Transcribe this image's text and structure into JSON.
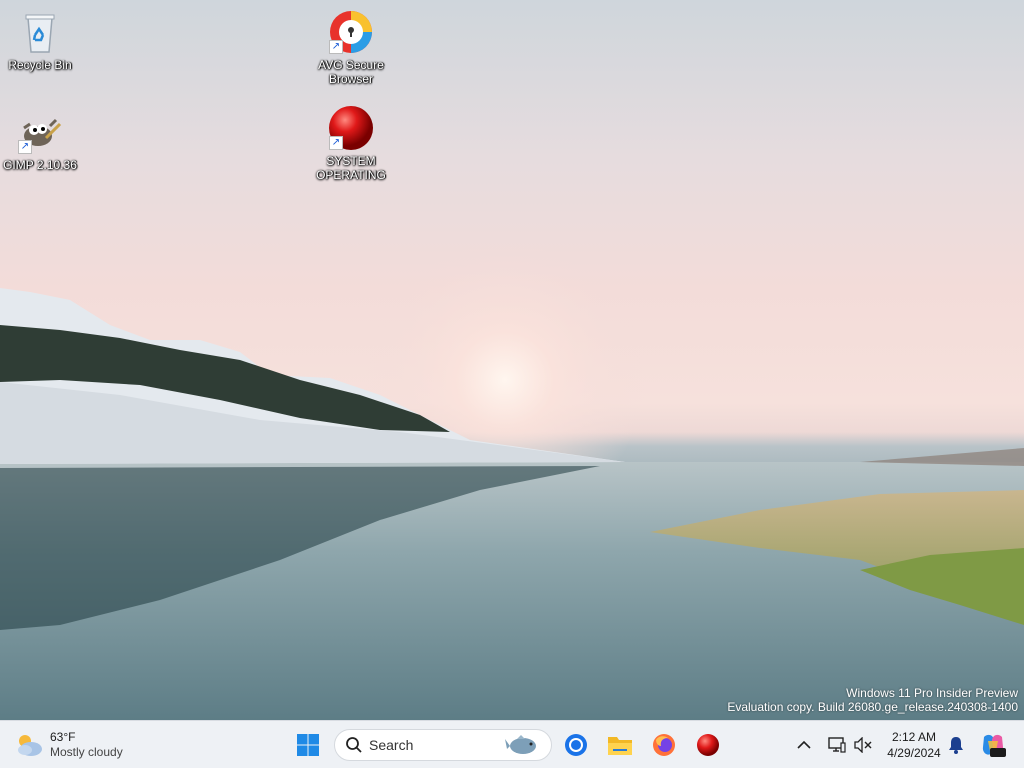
{
  "desktop": {
    "icons": [
      {
        "label": "Recycle Bin",
        "name": "recycle-bin"
      },
      {
        "label": "GIMP 2.10.36",
        "name": "gimp"
      },
      {
        "label": "AVG Secure Browser",
        "name": "avg-secure-browser"
      },
      {
        "label": "SYSTEM OPERATING",
        "name": "system-operating"
      }
    ],
    "watermark": {
      "line1": "Windows 11 Pro Insider Preview",
      "line2": "Evaluation copy. Build 26080.ge_release.240308-1400"
    }
  },
  "taskbar": {
    "weather": {
      "temp": "63°F",
      "condition": "Mostly cloudy",
      "icon": "partly-cloudy-icon"
    },
    "search_placeholder": "Search",
    "apps": [
      {
        "name": "start-button",
        "icon": "windows-logo-icon"
      },
      {
        "name": "chrome",
        "icon": "chrome-icon"
      },
      {
        "name": "file-explorer",
        "icon": "folder-icon"
      },
      {
        "name": "firefox",
        "icon": "firefox-icon"
      },
      {
        "name": "system-operating",
        "icon": "red-sphere-icon"
      }
    ],
    "tray": {
      "clock_time": "2:12 AM",
      "clock_date": "4/29/2024",
      "icons": [
        "chevron-up-icon",
        "network-icon",
        "volume-muted-icon",
        "bell-icon",
        "copilot-icon"
      ]
    }
  },
  "colors": {
    "accent": "#0067c0",
    "taskbar": "#eef1f5"
  }
}
